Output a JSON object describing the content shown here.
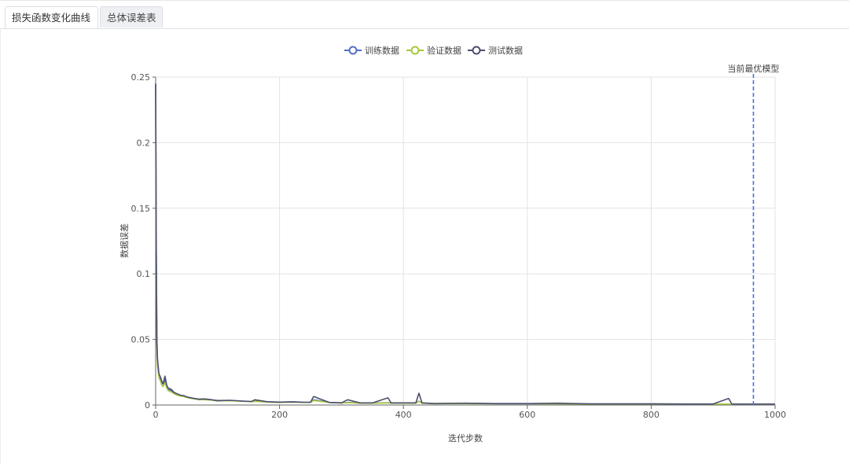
{
  "tabs": [
    {
      "label": "损失函数变化曲线",
      "active": true
    },
    {
      "label": "总体误差表",
      "active": false
    }
  ],
  "chart_data": {
    "type": "line",
    "xlabel": "迭代步数",
    "ylabel": "数据误差",
    "xlim": [
      0,
      1000
    ],
    "ylim": [
      0,
      0.25
    ],
    "xticks": [
      "0",
      "200",
      "400",
      "600",
      "800",
      "1000"
    ],
    "yticks": [
      "0",
      "0.05",
      "0.1",
      "0.15",
      "0.2",
      "0.25"
    ],
    "grid": true,
    "legend": "top-center",
    "marker_line": {
      "x": 965,
      "label": "当前最优模型",
      "color": "#4a6fe0"
    },
    "series": [
      {
        "name": "训练数据",
        "color": "#5470c6",
        "x": [
          0,
          1,
          2,
          3,
          4,
          5,
          6,
          8,
          10,
          12,
          15,
          18,
          20,
          25,
          30,
          35,
          40,
          45,
          50,
          60,
          70,
          80,
          90,
          100,
          120,
          140,
          155,
          160,
          180,
          200,
          220,
          240,
          250,
          255,
          280,
          300,
          310,
          330,
          350,
          375,
          380,
          400,
          420,
          425,
          430,
          450,
          500,
          550,
          600,
          650,
          700,
          750,
          800,
          850,
          900,
          925,
          930,
          950,
          1000
        ],
        "y": [
          0.245,
          0.12,
          0.05,
          0.033,
          0.028,
          0.024,
          0.022,
          0.02,
          0.017,
          0.016,
          0.019,
          0.014,
          0.012,
          0.011,
          0.009,
          0.008,
          0.007,
          0.007,
          0.006,
          0.005,
          0.004,
          0.0045,
          0.004,
          0.003,
          0.0035,
          0.003,
          0.0025,
          0.003,
          0.0025,
          0.002,
          0.0025,
          0.002,
          0.002,
          0.004,
          0.002,
          0.0015,
          0.002,
          0.0015,
          0.0015,
          0.0018,
          0.0015,
          0.0015,
          0.0015,
          0.003,
          0.0015,
          0.001,
          0.0012,
          0.001,
          0.001,
          0.001,
          0.0008,
          0.0008,
          0.0008,
          0.0007,
          0.0007,
          0.0007,
          0.0007,
          0.0006,
          0.0006
        ]
      },
      {
        "name": "验证数据",
        "color": "#a5c93a",
        "x": [
          0,
          1,
          2,
          3,
          4,
          5,
          6,
          8,
          10,
          12,
          15,
          18,
          20,
          25,
          30,
          35,
          40,
          45,
          50,
          60,
          70,
          80,
          90,
          100,
          120,
          140,
          155,
          160,
          180,
          200,
          220,
          240,
          250,
          255,
          280,
          300,
          310,
          330,
          350,
          375,
          380,
          400,
          420,
          425,
          430,
          450,
          500,
          550,
          600,
          650,
          700,
          750,
          800,
          850,
          900,
          925,
          930,
          950,
          1000
        ],
        "y": [
          0.24,
          0.1,
          0.045,
          0.03,
          0.026,
          0.022,
          0.02,
          0.018,
          0.015,
          0.014,
          0.017,
          0.013,
          0.011,
          0.01,
          0.0085,
          0.0075,
          0.0068,
          0.0065,
          0.0058,
          0.0048,
          0.0042,
          0.004,
          0.0038,
          0.0032,
          0.0033,
          0.0028,
          0.0026,
          0.0028,
          0.0023,
          0.002,
          0.0022,
          0.002,
          0.0019,
          0.0035,
          0.0019,
          0.0015,
          0.0018,
          0.0014,
          0.0014,
          0.0016,
          0.0014,
          0.0014,
          0.0014,
          0.0028,
          0.0014,
          0.0011,
          0.0011,
          0.001,
          0.001,
          0.0009,
          0.0008,
          0.0008,
          0.0008,
          0.0007,
          0.0007,
          0.0007,
          0.0007,
          0.0006,
          0.0006
        ]
      },
      {
        "name": "测试数据",
        "color": "#4e4e6e",
        "x": [
          0,
          1,
          2,
          3,
          4,
          5,
          6,
          8,
          10,
          12,
          15,
          18,
          20,
          25,
          30,
          35,
          40,
          45,
          50,
          60,
          70,
          80,
          90,
          100,
          120,
          140,
          155,
          160,
          180,
          200,
          220,
          240,
          250,
          255,
          280,
          300,
          310,
          330,
          350,
          375,
          380,
          400,
          420,
          425,
          430,
          450,
          500,
          550,
          600,
          650,
          700,
          750,
          800,
          850,
          900,
          925,
          930,
          950,
          1000
        ],
        "y": [
          0.245,
          0.11,
          0.048,
          0.035,
          0.03,
          0.025,
          0.023,
          0.021,
          0.018,
          0.016,
          0.022,
          0.015,
          0.013,
          0.012,
          0.0095,
          0.0085,
          0.0075,
          0.0072,
          0.0062,
          0.0052,
          0.0045,
          0.0046,
          0.004,
          0.0034,
          0.0036,
          0.003,
          0.0027,
          0.004,
          0.0025,
          0.0022,
          0.0024,
          0.0021,
          0.0021,
          0.0065,
          0.002,
          0.0017,
          0.004,
          0.0016,
          0.0016,
          0.0055,
          0.0016,
          0.0016,
          0.0016,
          0.009,
          0.0016,
          0.0012,
          0.0014,
          0.0011,
          0.0011,
          0.0014,
          0.0009,
          0.0009,
          0.0009,
          0.0008,
          0.0008,
          0.005,
          0.0008,
          0.0007,
          0.0007
        ]
      }
    ]
  }
}
